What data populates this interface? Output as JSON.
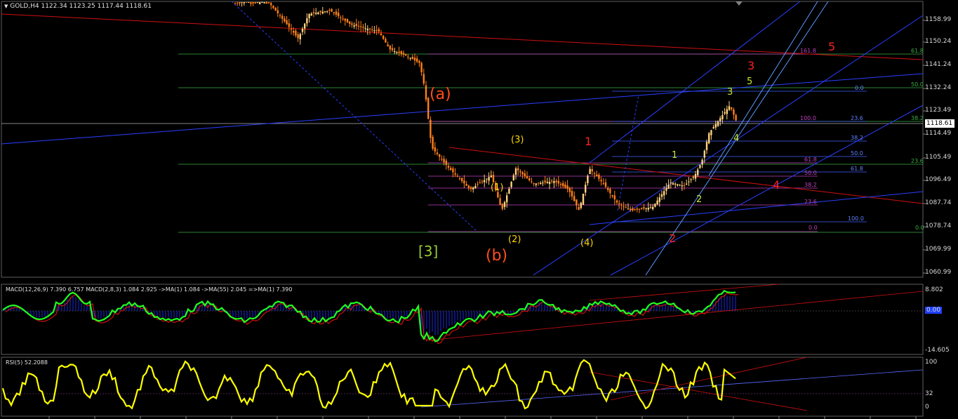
{
  "chart": {
    "symbol_header": "GOLD,H4  1122.34 1123.25 1117.44 1118.61",
    "current_price": "1118.61",
    "price_scale": [
      "1158.99",
      "1150.24",
      "1141.24",
      "1132.24",
      "1123.49",
      "1114.49",
      "1105.49",
      "1096.49",
      "1087.74",
      "1078.74",
      "1069.99",
      "1060.99"
    ],
    "wave_labels": [
      {
        "text": "(a)",
        "color": "#ff4d1a"
      },
      {
        "text": "(b)",
        "color": "#ff4d1a"
      },
      {
        "text": "[3]",
        "color": "#9acd32"
      },
      {
        "text": "(1)",
        "color": "#ffd700"
      },
      {
        "text": "(2)",
        "color": "#ffd700"
      },
      {
        "text": "(3)",
        "color": "#ffd700"
      },
      {
        "text": "(4)",
        "color": "#ffd700"
      },
      {
        "text": "1",
        "color": "#ff2020"
      },
      {
        "text": "2",
        "color": "#ff2020"
      },
      {
        "text": "3",
        "color": "#ff2020"
      },
      {
        "text": "4",
        "color": "#ff2020"
      },
      {
        "text": "5",
        "color": "#ff2020"
      },
      {
        "text": "1",
        "color": "#c8e632"
      },
      {
        "text": "2",
        "color": "#c8e632"
      },
      {
        "text": "3",
        "color": "#c8e632"
      },
      {
        "text": "4",
        "color": "#c8e632"
      },
      {
        "text": "5",
        "color": "#c8e632"
      }
    ],
    "fib_labels": [
      {
        "text": "161.8",
        "color": "#c040c0"
      },
      {
        "text": "100.0",
        "color": "#c040c0"
      },
      {
        "text": "61.8",
        "color": "#c040c0"
      },
      {
        "text": "50.0",
        "color": "#c040c0"
      },
      {
        "text": "38.2",
        "color": "#c040c0"
      },
      {
        "text": "23.6",
        "color": "#c040c0"
      },
      {
        "text": "0.0",
        "color": "#c040c0"
      },
      {
        "text": "0.0",
        "color": "#6080ff"
      },
      {
        "text": "23.6",
        "color": "#6080ff"
      },
      {
        "text": "38.2",
        "color": "#6080ff"
      },
      {
        "text": "50.0",
        "color": "#6080ff"
      },
      {
        "text": "61.8",
        "color": "#6080ff"
      },
      {
        "text": "100.0",
        "color": "#6080ff"
      },
      {
        "text": "61.8",
        "color": "#3cb043"
      },
      {
        "text": "50.0",
        "color": "#3cb043"
      },
      {
        "text": "38.2",
        "color": "#3cb043"
      },
      {
        "text": "23.6",
        "color": "#3cb043"
      },
      {
        "text": "0.0",
        "color": "#3cb043"
      }
    ]
  },
  "macd": {
    "header": "MACD(12,26,9) 7.390 6.757  MACD(2,8,3) 1.084 2.925  ->MA(1) 1.084  ->MA(55) 2.045  =>MA(1) 7.390",
    "scale": [
      "8.802",
      "0.00",
      "-14.605"
    ]
  },
  "rsi": {
    "header": "RSI(5) 52.2088",
    "scale": [
      "100",
      "32",
      "0"
    ]
  },
  "colors": {
    "background": "#000000",
    "bull_candle": "#ffd27f",
    "bear_candle": "#ff7f1a",
    "channel": "#2a3fff",
    "trend_red": "#d01010",
    "macd_line": "#20ff20",
    "rsi_line": "#ffff00"
  }
}
